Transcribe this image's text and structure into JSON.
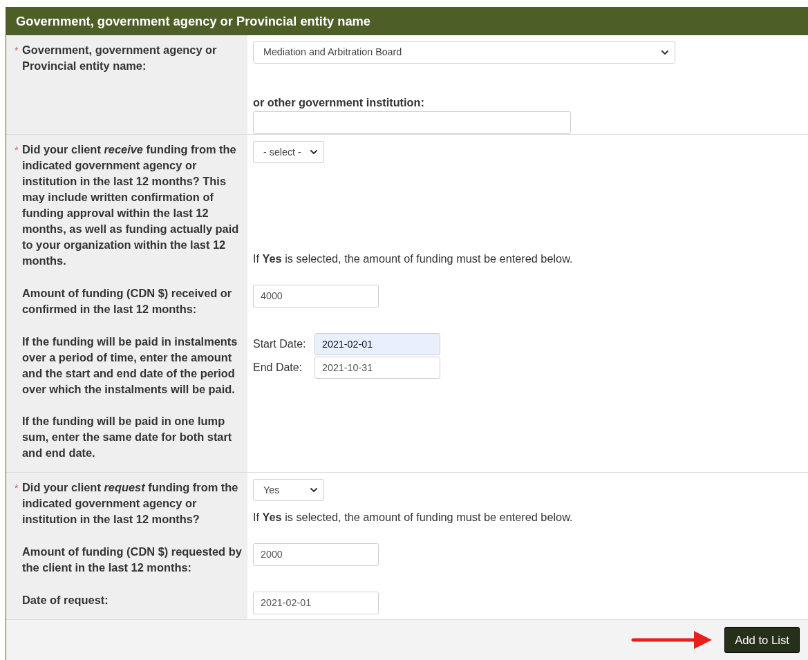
{
  "header": {
    "title": "Government, government agency or Provincial entity name"
  },
  "sections": [
    {
      "rows": [
        {
          "marker": "*",
          "label": [
            "Government, government agency or Provincial entity name:"
          ],
          "controls": [
            {
              "kind": "select-wide",
              "value": "Mediation and Arbitration Board"
            },
            {
              "kind": "heading",
              "text": "or other government institution:"
            },
            {
              "kind": "input-wide"
            }
          ]
        }
      ]
    },
    {
      "rows": [
        {
          "marker": "*",
          "label": [
            "Did your client *receive* funding from the indicated government agency or institution in the last 12 months? This may include written confirmation of funding approval within the last 12 months, as well as funding actually paid to your organization within the last 12 months."
          ],
          "controls": [
            {
              "kind": "select",
              "value": "- select -"
            },
            {
              "kind": "note",
              "text": "If **Yes** is selected, the amount of funding must be entered below."
            }
          ]
        },
        {
          "label": [
            "Amount of funding (CDN $) received or confirmed in the last 12 months:"
          ],
          "controls": [
            {
              "kind": "input",
              "value": "4000"
            }
          ]
        },
        {
          "label": [
            "If the funding will be paid in instalments over a period of time, enter the amount and the start and end date of the period over which the instalments will be paid.",
            "If the funding will be paid in one lump sum, enter the same date for both start and end date."
          ],
          "controls": [
            {
              "kind": "date",
              "label": "Start Date:",
              "value": "2021-02-01",
              "focused": true
            },
            {
              "kind": "date",
              "label": "End Date:",
              "value": "2021-10-31",
              "focused": false
            }
          ]
        }
      ]
    },
    {
      "rows": [
        {
          "marker": "*",
          "label": [
            "Did your client *request* funding from the indicated government agency or institution in the last 12 months?"
          ],
          "controls": [
            {
              "kind": "select",
              "value": "Yes"
            },
            {
              "kind": "note",
              "text": "If **Yes** is selected, the amount of funding must be entered below."
            }
          ]
        },
        {
          "label": [
            "Amount of funding (CDN $) requested by the client in the last 12 months:"
          ],
          "controls": [
            {
              "kind": "input",
              "value": "2000"
            }
          ]
        },
        {
          "label": [
            "Date of request:"
          ],
          "controls": [
            {
              "kind": "input",
              "value": "2021-02-01"
            }
          ]
        }
      ]
    }
  ],
  "footer": {
    "button": "Add to List"
  }
}
